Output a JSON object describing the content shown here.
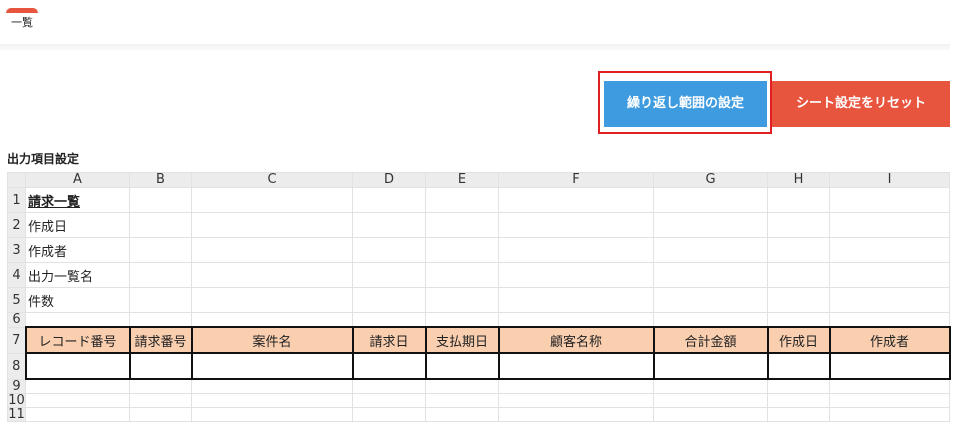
{
  "tabs": [
    {
      "label": "一覧"
    }
  ],
  "buttons": {
    "repeat_label": "繰り返し範囲の設定",
    "reset_label": "シート設定をリセット"
  },
  "section_title": "出力項目設定",
  "sheet": {
    "columns": [
      "A",
      "B",
      "C",
      "D",
      "E",
      "F",
      "G",
      "H",
      "I"
    ],
    "row_numbers": [
      "1",
      "2",
      "3",
      "4",
      "5",
      "6",
      "7",
      "8",
      "9",
      "10",
      "11"
    ],
    "cells": {
      "a1": "請求一覧",
      "a2": "作成日",
      "a3": "作成者",
      "a4": "出力一覧名",
      "a5": "件数"
    },
    "header_row": [
      "レコード番号",
      "請求番号",
      "案件名",
      "請求日",
      "支払期日",
      "顧客名称",
      "合計金額",
      "作成日",
      "作成者"
    ]
  }
}
